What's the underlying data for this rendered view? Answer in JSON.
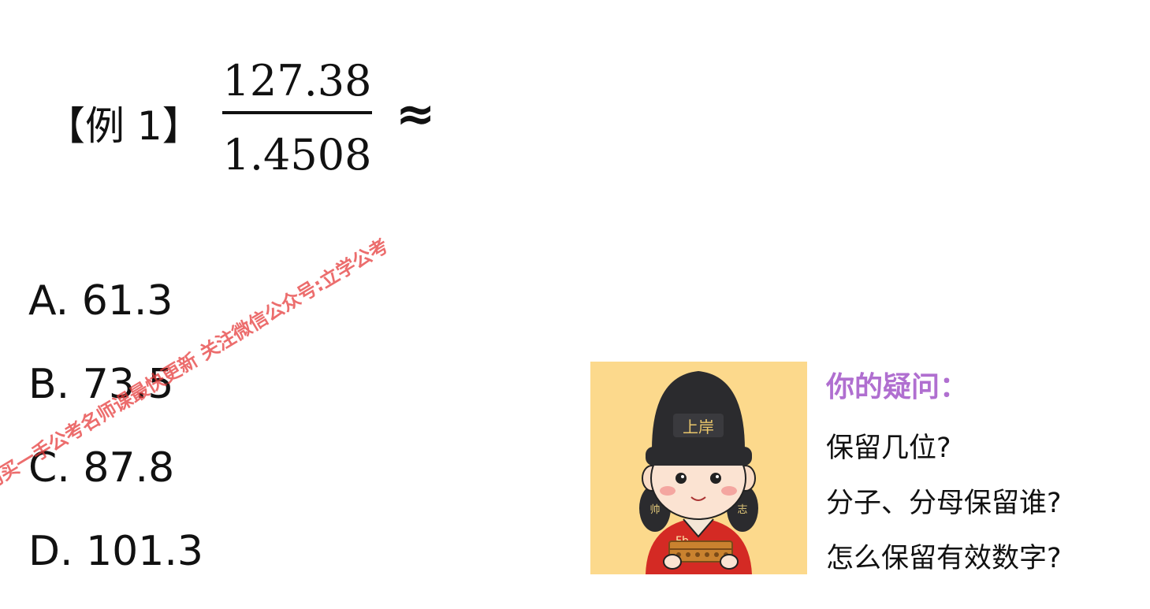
{
  "question": {
    "label": "【例 1】",
    "numerator": "127.38",
    "denominator": "1.4508",
    "operator": "≈"
  },
  "options": [
    {
      "text": "A. 61.3"
    },
    {
      "text": "B. 73.5"
    },
    {
      "text": "C. 87.8"
    },
    {
      "text": "D. 101.3"
    }
  ],
  "avatar": {
    "hat_text": "上岸",
    "left_tassel": "帅",
    "right_tassel": "志",
    "shirt_text": "Fb"
  },
  "doubts": {
    "title": "你的疑问：",
    "items": [
      "保留几位?",
      "分子、分母保留谁?",
      "怎么保留有效数字?"
    ]
  },
  "watermark": "购买一手公考名师课最快更新 关注微信公众号:立学公考",
  "colors": {
    "avatar_background": "#fcd98c",
    "doubt_title": "#b06fd0",
    "watermark": "#e63c3c"
  }
}
